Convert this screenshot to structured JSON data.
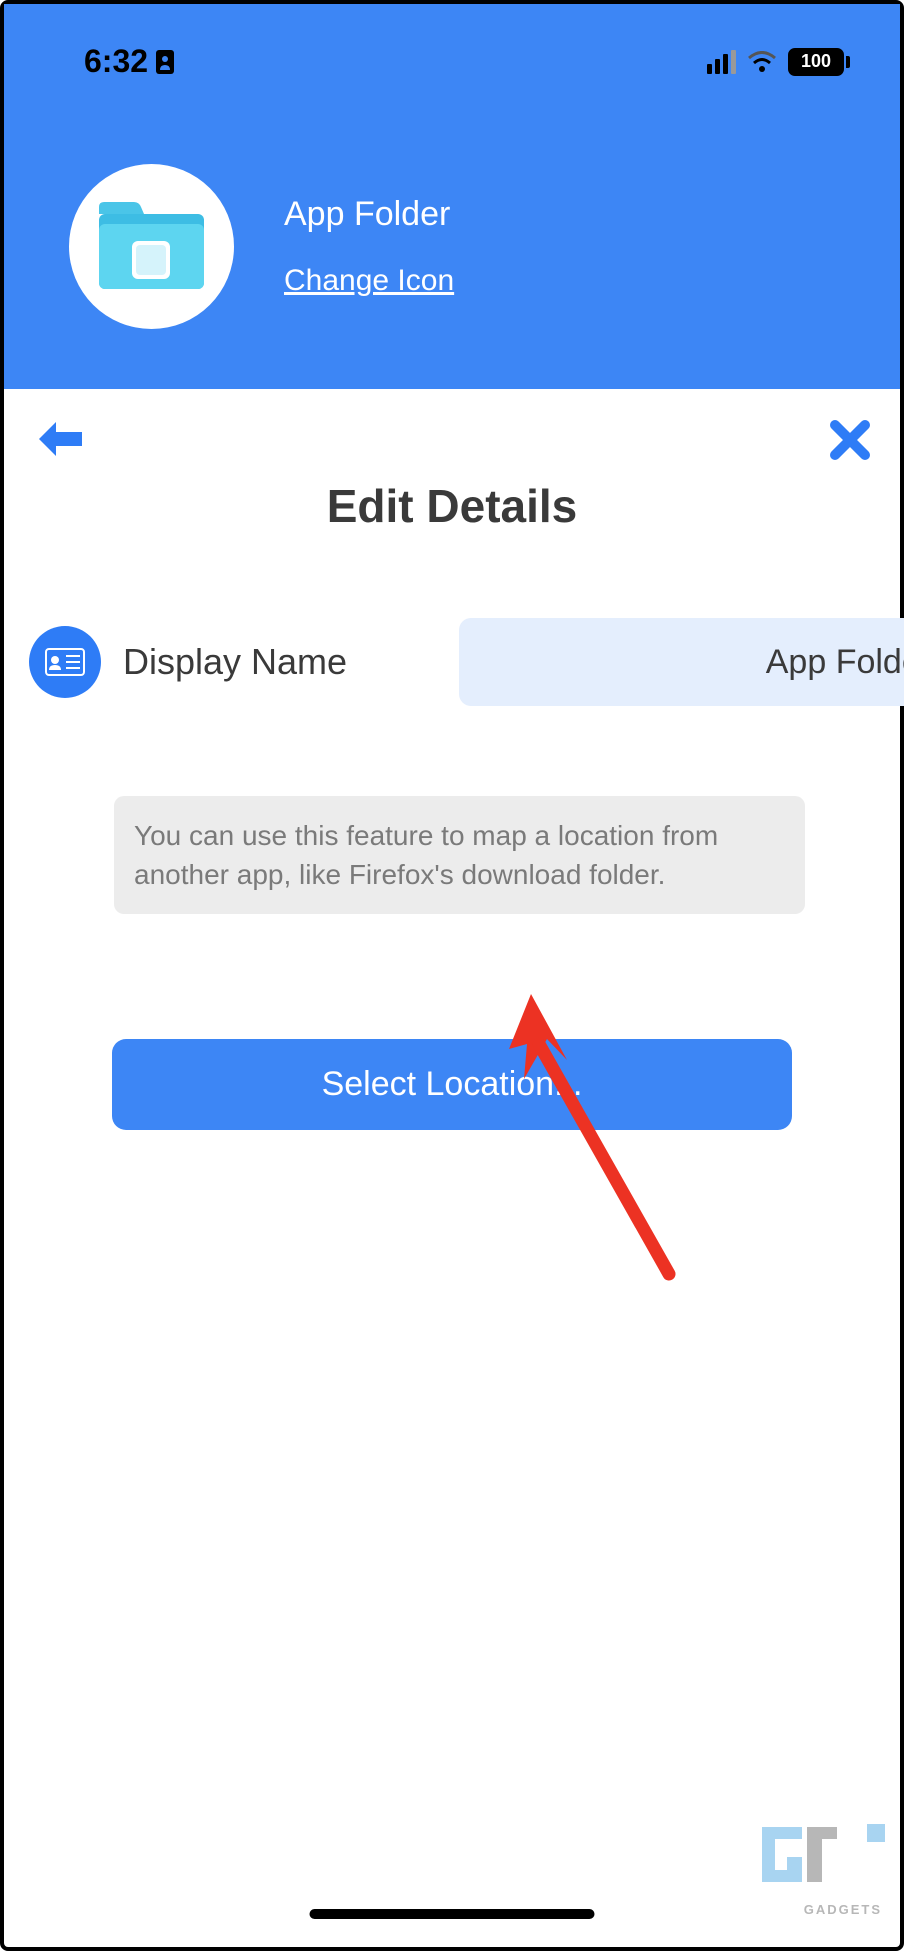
{
  "statusBar": {
    "time": "6:32",
    "battery": "100"
  },
  "header": {
    "title": "App Folder",
    "changeIconLabel": "Change Icon"
  },
  "page": {
    "title": "Edit Details"
  },
  "field": {
    "label": "Display Name",
    "value": "App Folder"
  },
  "hint": {
    "text": "You can use this feature to map a location from another app, like Firefox's download folder."
  },
  "actions": {
    "selectLocation": "Select Location..."
  },
  "watermark": {
    "text": "GADGETS"
  }
}
